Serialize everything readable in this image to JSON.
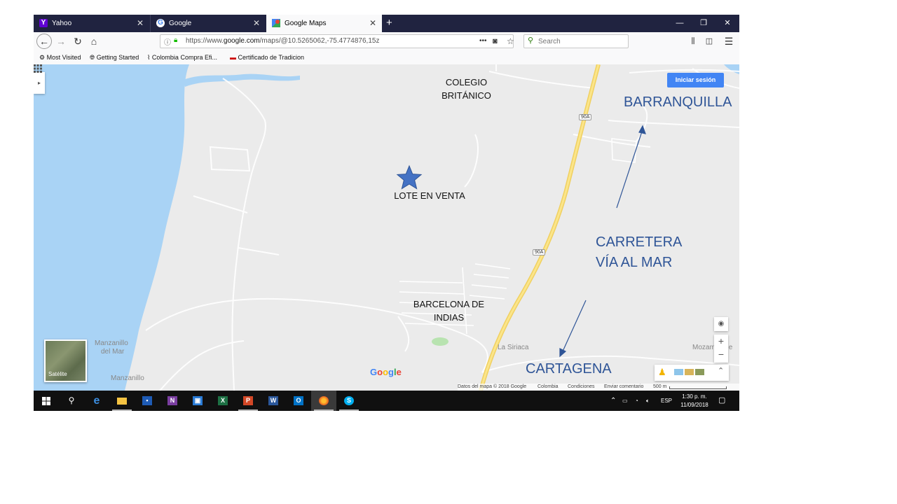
{
  "browser": {
    "tabs": [
      {
        "label": "Yahoo",
        "icon": "yahoo-icon"
      },
      {
        "label": "Google",
        "icon": "google-icon"
      },
      {
        "label": "Google Maps",
        "icon": "google-maps-icon"
      }
    ],
    "url": {
      "prefix": "https://www.",
      "domain": "google.com",
      "path": "/maps/@10.5265062,-75.4774876,15z"
    },
    "search_placeholder": "Search",
    "bookmarks": [
      {
        "label": "Most Visited",
        "icon": "gear-icon"
      },
      {
        "label": "Getting Started",
        "icon": "globe-icon"
      },
      {
        "label": "Colombia Compra Efi...",
        "icon": "rss-icon"
      },
      {
        "label": "Certificado de Tradicion",
        "icon": "flag-icon"
      }
    ]
  },
  "map": {
    "signin_label": "Iniciar sesión",
    "satellite_label": "Satélite",
    "google_logo": "Google",
    "road_badge": "90A",
    "place_labels": {
      "manzanillo_del_mar_1": "Manzanillo",
      "manzanillo_del_mar_2": "del Mar",
      "manzanillo": "Manzanillo",
      "la_siriaca": "La Siriaca",
      "mozambique": "Mozambique"
    },
    "footer": {
      "data": "Datos del mapa © 2018 Google",
      "country": "Colombia",
      "terms": "Condiciones",
      "feedback": "Enviar comentario",
      "scale": "500 m"
    }
  },
  "annotations": {
    "colegio_1": "COLEGIO",
    "colegio_2": "BRITÁNICO",
    "lote": "LOTE EN VENTA",
    "barcelona_1": "BARCELONA DE",
    "barcelona_2": "INDIAS",
    "barranquilla": "BARRANQUILLA",
    "carretera_1": "CARRETERA",
    "carretera_2": "VÍA AL MAR",
    "cartagena": "CARTAGENA",
    "annotation_color": "#2f5597"
  },
  "taskbar": {
    "apps": [
      "start-icon",
      "search-icon",
      "edge-icon",
      "file-explorer-icon",
      "app-icon",
      "onenote-icon",
      "remote-desktop-icon",
      "excel-icon",
      "powerpoint-icon",
      "word-icon",
      "outlook-icon",
      "firefox-icon",
      "skype-icon"
    ],
    "language": "ESP",
    "time": "1:30 p. m.",
    "date": "11/09/2018"
  }
}
